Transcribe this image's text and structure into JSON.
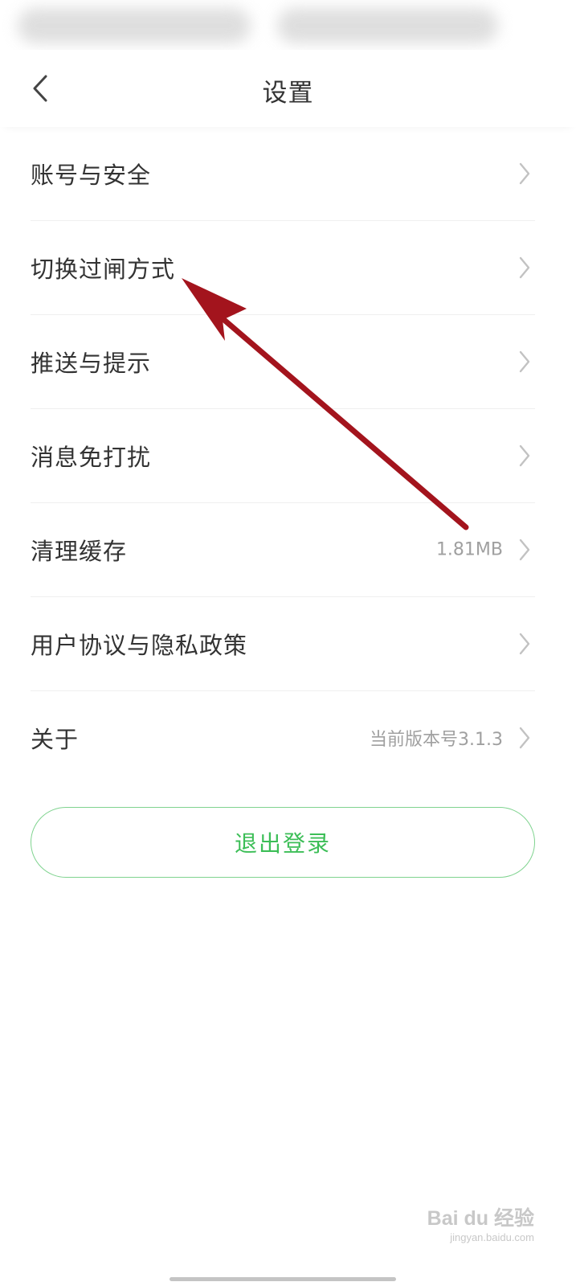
{
  "header": {
    "title": "设置",
    "back_icon": "chevron-left-icon"
  },
  "settings": {
    "items": [
      {
        "label": "账号与安全",
        "value": ""
      },
      {
        "label": "切换过闸方式",
        "value": ""
      },
      {
        "label": "推送与提示",
        "value": ""
      },
      {
        "label": "消息免打扰",
        "value": ""
      },
      {
        "label": "清理缓存",
        "value": "1.81MB"
      },
      {
        "label": "用户协议与隐私政策",
        "value": ""
      },
      {
        "label": "关于",
        "value": "当前版本号3.1.3"
      }
    ]
  },
  "logout": {
    "label": "退出登录"
  },
  "watermark": {
    "main": "Bai du 经验",
    "sub": "jingyan.baidu.com"
  },
  "colors": {
    "accent_green": "#3cbe57",
    "arrow_red": "#a3141d",
    "text_primary": "#333333",
    "text_secondary": "#a0a0a0"
  }
}
